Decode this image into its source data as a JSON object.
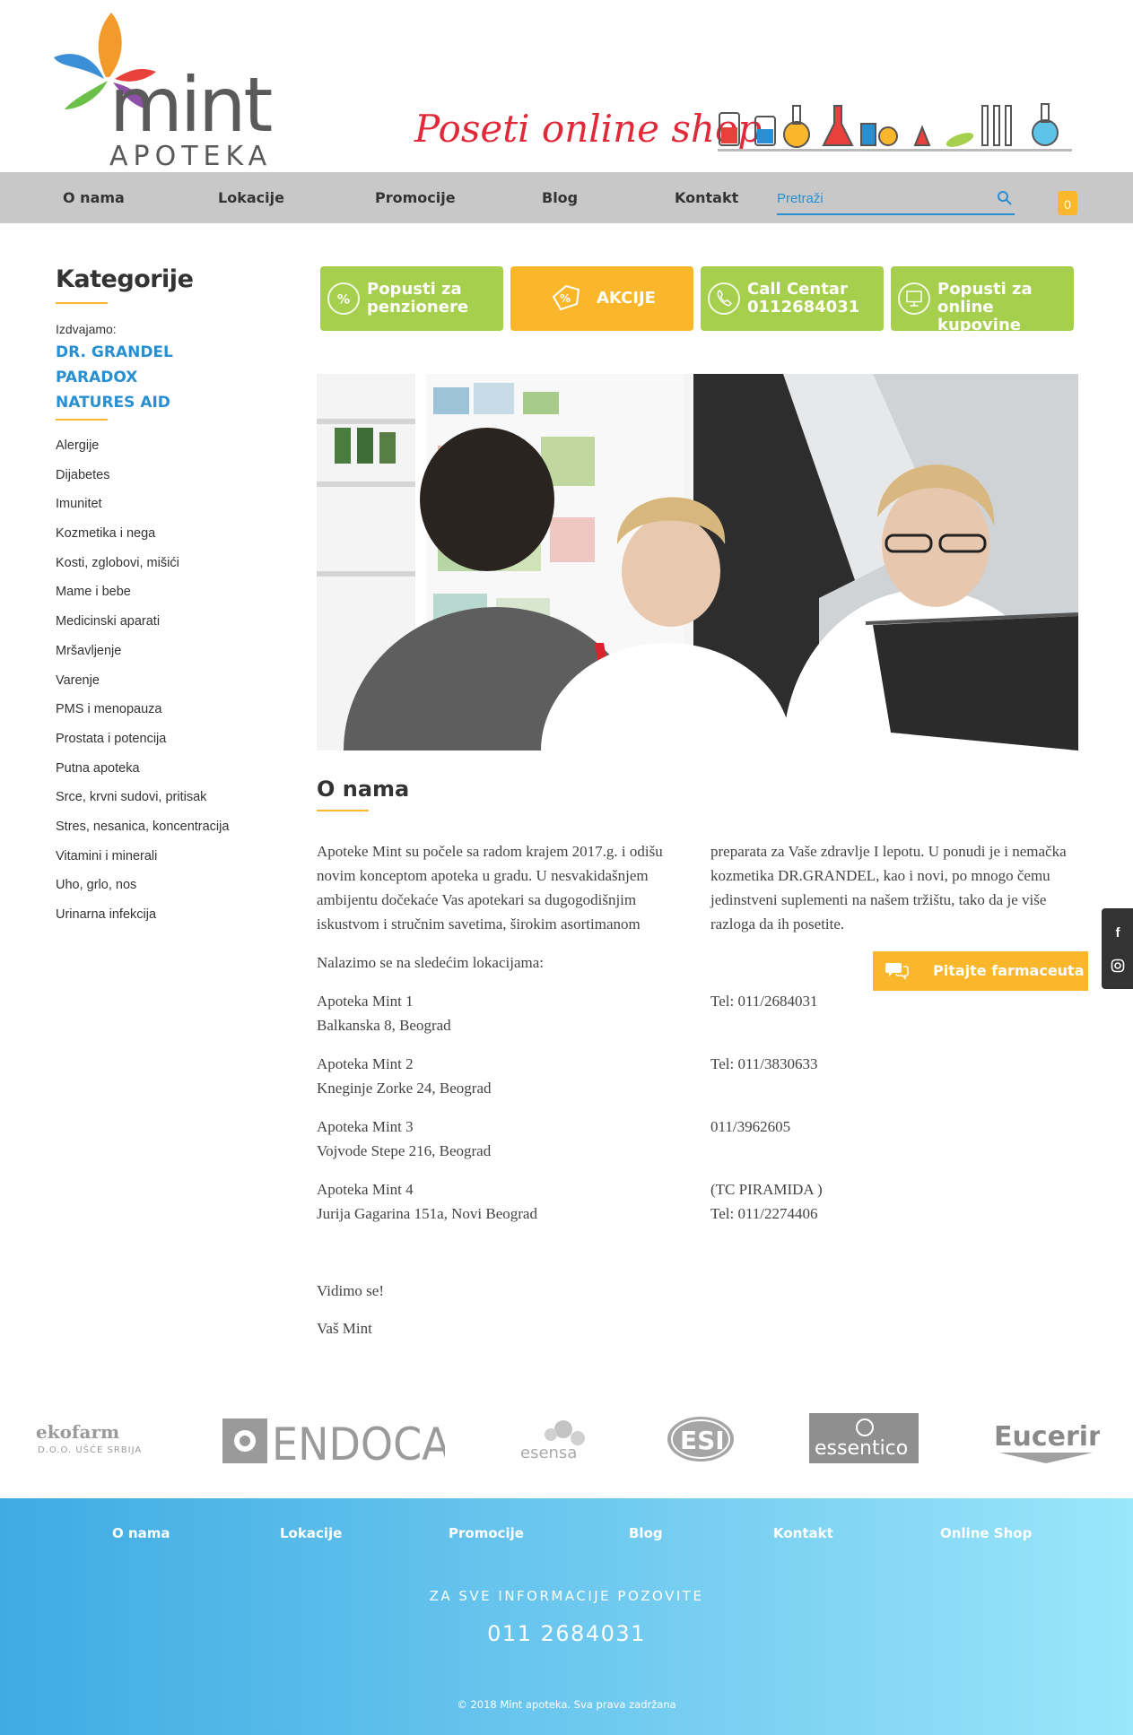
{
  "logo": {
    "word": "mint",
    "sub": "APOTEKA"
  },
  "banner": {
    "text": "Poseti online shop"
  },
  "nav": [
    "O nama",
    "Lokacije",
    "Promocije",
    "Blog",
    "Kontakt"
  ],
  "search": {
    "placeholder": "Pretraži"
  },
  "cart": {
    "count": "0"
  },
  "sidebar": {
    "title": "Kategorije",
    "featured_label": "Izdvajamo:",
    "brands": [
      "DR. GRANDEL",
      "PARADOX",
      "NATURES AID"
    ],
    "categories": [
      "Alergije",
      "Dijabetes",
      "Imunitet",
      "Kozmetika i nega",
      "Kosti, zglobovi, mišići",
      "Mame i bebe",
      "Medicinski aparati",
      "Mršavljenje",
      "Varenje",
      "PMS i menopauza",
      "Prostata i potencija",
      "Putna apoteka",
      "Srce, krvni sudovi, pritisak",
      "Stres, nesanica, koncentracija",
      "Vitamini i minerali",
      "Uho, grlo, nos",
      "Urinarna infekcija"
    ]
  },
  "actions": [
    {
      "label1": "Popusti za",
      "label2": "penzionere"
    },
    {
      "label1": "AKCIJE",
      "label2": ""
    },
    {
      "label1": "Call Centar",
      "label2": "0112684031"
    },
    {
      "label1": "Popusti za",
      "label2": "online kupovine"
    }
  ],
  "content": {
    "title": "O nama",
    "intro_left": "Apoteke Mint su počele sa radom krajem 2017.g. i odišu novim konceptom apoteka u gradu. U nesvakidašnjem ambijentu dočekaće Vas apotekari sa dugogodišnjim iskustvom i stručnim savetima, širokim asortimanom",
    "intro_right": "preparata za Vaše zdravlje I lepotu. U ponudi je i nemačka kozmetika DR.GRANDEL, kao i novi, po mnogo čemu jedinstveni suplementi na našem tržištu, tako da je više razloga da ih posetite.",
    "locations_title": "Nalazimo se na sledećim lokacijama:",
    "locations": [
      {
        "name": "Apoteka Mint 1",
        "address": "Balkanska 8, Beograd",
        "right1": "Tel: 011/2684031",
        "right2": ""
      },
      {
        "name": "Apoteka Mint 2",
        "address": "Kneginje Zorke 24, Beograd",
        "right1": "Tel: 011/3830633",
        "right2": ""
      },
      {
        "name": "Apoteka Mint 3",
        "address": "Vojvode Stepe 216, Beograd",
        "right1": "011/3962605",
        "right2": ""
      },
      {
        "name": "Apoteka Mint 4",
        "address": "Jurija Gagarina 151a, Novi Beograd",
        "right1": "(TC PIRAMIDA )",
        "right2": "Tel: 011/2274406"
      }
    ],
    "closing1": "Vidimo se!",
    "closing2": "Vaš Mint"
  },
  "ask_button": "Pitajte farmaceuta",
  "brands_logos": [
    "ekofarm",
    "D.O.O. UŠĆE SRBIJA",
    "ENDOCARE",
    "esensa",
    "ESI",
    "essentico",
    "Eucerin"
  ],
  "footer": {
    "nav": [
      "O nama",
      "Lokacije",
      "Promocije",
      "Blog",
      "Kontakt",
      "Online Shop"
    ],
    "info": "ZA SVE INFORMACIJE POZOVITE",
    "phone": "011 2684031",
    "copyright": "© 2018 Mint apoteka. Sva prava zadržana"
  },
  "colors": {
    "accent": "#fbb72b",
    "green": "#a6cf4e",
    "blue": "#2a8fd0",
    "nav_bg": "#c8c8c8"
  }
}
